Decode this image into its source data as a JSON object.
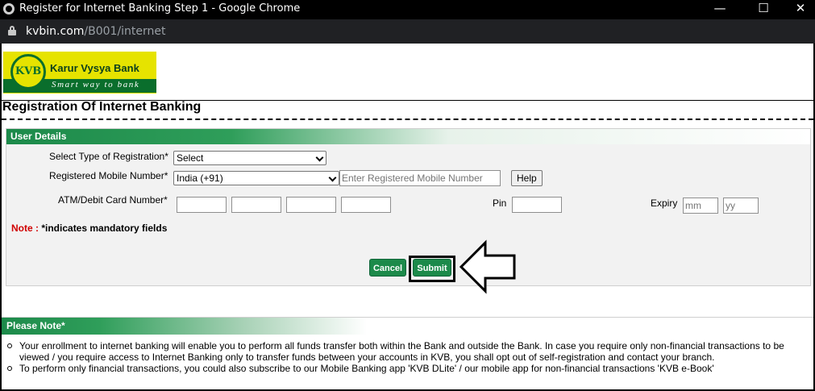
{
  "window": {
    "title": "Register for Internet Banking Step 1 - Google Chrome",
    "min_glyph": "—",
    "max_glyph": "☐",
    "close_glyph": "✕",
    "url_host": "kvbin.com",
    "url_path": "/B001/internet"
  },
  "logo": {
    "initials": "KVB",
    "name": "Karur Vysya Bank",
    "tagline": "Smart way to bank"
  },
  "page_title": "Registration Of Internet Banking",
  "user_details": {
    "heading": "User Details",
    "registration_type_label": "Select Type of Registration*",
    "registration_type_value": "Select",
    "mobile_label": "Registered Mobile Number*",
    "country_code_value": "India (+91)",
    "mobile_placeholder": "Enter Registered Mobile Number",
    "help_label": "Help",
    "card_label": "ATM/Debit Card Number*",
    "pin_label": "Pin",
    "expiry_label": "Expiry",
    "expiry_mm_placeholder": "mm",
    "expiry_yy_placeholder": "yy",
    "note_prefix": "Note : ",
    "note_text": "*indicates mandatory fields",
    "cancel_label": "Cancel",
    "submit_label": "Submit"
  },
  "please_note": {
    "heading": "Please Note*",
    "items": [
      "Your enrollment to internet banking will enable you to perform all funds transfer both within the Bank and outside the Bank. In case you require only non-financial transactions to be viewed / you require access to Internet Banking only to transfer funds between your accounts in KVB, you shall opt out of self-registration and contact your branch.",
      "To perform only financial transactions, you could also subscribe to our Mobile Banking app 'KVB DLite' / our mobile app for non-financial transactions 'KVB e-Book'"
    ]
  },
  "colors": {
    "brand_green": "#1c8a4a",
    "brand_yellow": "#e6e300",
    "note_red": "#d00000"
  }
}
